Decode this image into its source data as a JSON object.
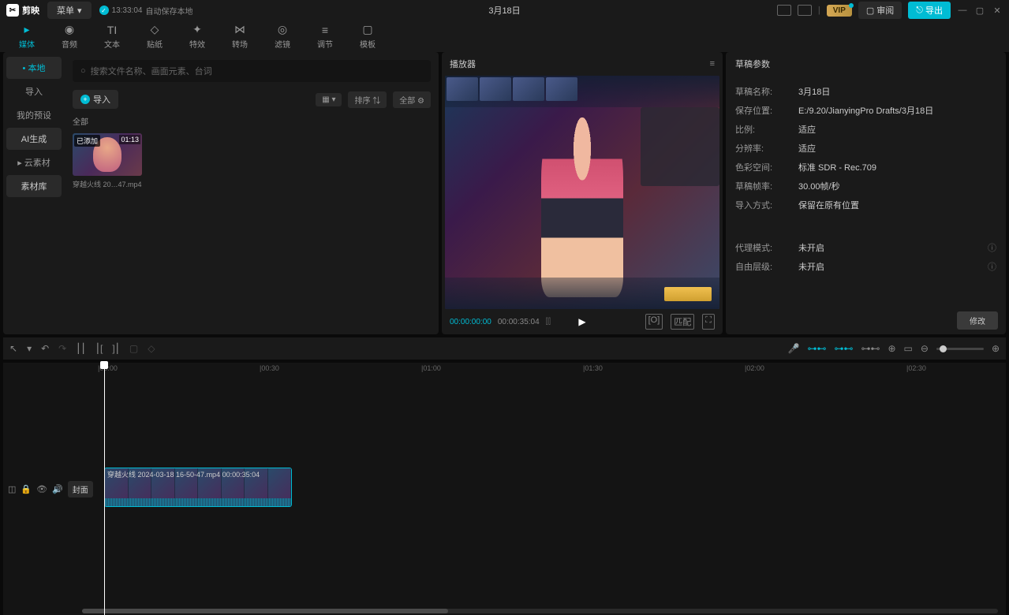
{
  "titlebar": {
    "app_name": "剪映",
    "menu": "菜单",
    "autosave_time": "13:33:04",
    "autosave_text": "自动保存本地",
    "project_title": "3月18日",
    "vip": "VIP",
    "review": "审阅",
    "export": "导出"
  },
  "top_tabs": [
    {
      "icon": "▸",
      "label": "媒体"
    },
    {
      "icon": "◉",
      "label": "音频"
    },
    {
      "icon": "TI",
      "label": "文本"
    },
    {
      "icon": "◇",
      "label": "贴纸"
    },
    {
      "icon": "✦",
      "label": "特效"
    },
    {
      "icon": "⋈",
      "label": "转场"
    },
    {
      "icon": "◎",
      "label": "滤镜"
    },
    {
      "icon": "≡",
      "label": "调节"
    },
    {
      "icon": "▢",
      "label": "模板"
    }
  ],
  "left_sidebar": [
    {
      "label": "• 本地",
      "cls": "active"
    },
    {
      "label": "导入",
      "cls": ""
    },
    {
      "label": "我的预设",
      "cls": ""
    },
    {
      "label": "AI生成",
      "cls": "boxed"
    },
    {
      "label": "▸ 云素材",
      "cls": ""
    },
    {
      "label": "素材库",
      "cls": "boxed"
    }
  ],
  "search_placeholder": "搜索文件名称、画面元素、台词",
  "import_btn": "导入",
  "view": {
    "grid": "▦ ▾",
    "sort": "排序 ⇅",
    "all": "全部 ⚙"
  },
  "category_all": "全部",
  "media": {
    "badge": "已添加",
    "duration": "01:13",
    "name": "穿越火线 20…47.mp4"
  },
  "player": {
    "title": "播放器",
    "time_current": "00:00:00:00",
    "time_total": "00:00:35:04",
    "ratio_label": "[O]",
    "scale_label": "匹配"
  },
  "props": {
    "title": "草稿参数",
    "rows": [
      {
        "label": "草稿名称:",
        "value": "3月18日"
      },
      {
        "label": "保存位置:",
        "value": "E:/9.20/JianyingPro Drafts/3月18日"
      },
      {
        "label": "比例:",
        "value": "适应"
      },
      {
        "label": "分辨率:",
        "value": "适应"
      },
      {
        "label": "色彩空间:",
        "value": "标准 SDR - Rec.709"
      },
      {
        "label": "草稿帧率:",
        "value": "30.00帧/秒"
      },
      {
        "label": "导入方式:",
        "value": "保留在原有位置"
      }
    ],
    "extra": [
      {
        "label": "代理模式:",
        "value": "未开启"
      },
      {
        "label": "自由层级:",
        "value": "未开启"
      }
    ],
    "modify": "修改"
  },
  "timeline": {
    "ticks": [
      "00:00",
      "00:30",
      "01:00",
      "01:30",
      "02:00",
      "02:30"
    ],
    "clip_label": "穿越火线 2024-03-18 16-50-47.mp4  00:00:35:04",
    "cover": "封面"
  }
}
